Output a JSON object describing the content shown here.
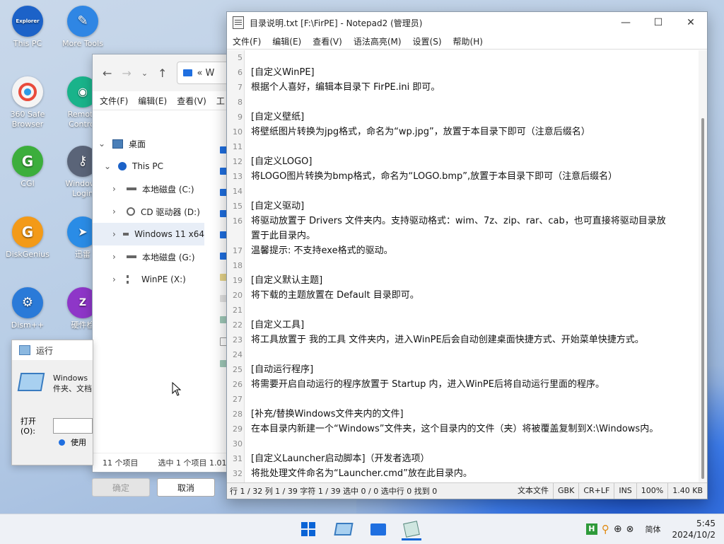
{
  "desktop_icons": [
    {
      "label": "This PC",
      "badge": "Explorer",
      "color": "#1c62c8"
    },
    {
      "label": "More Tools",
      "color": "#2f86e4"
    },
    {
      "label": "360 Safe Browser",
      "color": "#f4f4f4"
    },
    {
      "label": "Remote Control",
      "color": "#19b38a"
    },
    {
      "label": "CGI",
      "badge": "G",
      "color": "#3cae3c"
    },
    {
      "label": "Windows Login",
      "color": "#5a6478"
    },
    {
      "label": "DiskGenius",
      "badge": "G",
      "color": "#f39a18"
    },
    {
      "label": "迅雷",
      "color": "#2a8ce6"
    },
    {
      "label": "Dism++",
      "color": "#2a7ad8"
    },
    {
      "label": "硬件检",
      "badge": "Z",
      "color": "#8e36c8"
    }
  ],
  "explorer": {
    "address": "« W",
    "menu": [
      "文件(F)",
      "编辑(E)",
      "查看(V)",
      "工"
    ],
    "tree": [
      {
        "label": "桌面",
        "indent": 0,
        "expander": "⌄"
      },
      {
        "label": "This PC",
        "indent": 1,
        "expander": "⌄"
      },
      {
        "label": "本地磁盘 (C:)",
        "indent": 2,
        "expander": "›"
      },
      {
        "label": "CD 驱动器 (D:)",
        "indent": 2,
        "expander": "›"
      },
      {
        "label": "Windows 11 x64",
        "indent": 2,
        "expander": "›",
        "selected": true
      },
      {
        "label": "本地磁盘 (G:)",
        "indent": 2,
        "expander": "›"
      },
      {
        "label": "WinPE (X:)",
        "indent": 2,
        "expander": "›"
      }
    ],
    "status_count": "11 个项目",
    "status_selected": "选中 1 个项目 1.01"
  },
  "run_dialog": {
    "title": "运行",
    "desc_line1": "Windows",
    "desc_line2": "件夹、文档",
    "open_label": "打开(O):",
    "admin_label": "使用",
    "ok_label": "确定",
    "cancel_label": "取消"
  },
  "notepad": {
    "title": "目录说明.txt [F:\\FirPE] - Notepad2 (管理员)",
    "menu": [
      "文件(F)",
      "编辑(E)",
      "查看(V)",
      "语法高亮(M)",
      "设置(S)",
      "帮助(H)"
    ],
    "lines": [
      {
        "n": "5",
        "t": ""
      },
      {
        "n": "6",
        "t": "[自定义WinPE]"
      },
      {
        "n": "7",
        "t": "根据个人喜好，编辑本目录下 FirPE.ini 即可。"
      },
      {
        "n": "8",
        "t": ""
      },
      {
        "n": "9",
        "t": "[自定义壁纸]"
      },
      {
        "n": "10",
        "t": "将壁纸图片转换为jpg格式，命名为“wp.jpg”，放置于本目录下即可（注意后缀名）"
      },
      {
        "n": "11",
        "t": ""
      },
      {
        "n": "12",
        "t": "[自定义LOGO]"
      },
      {
        "n": "13",
        "t": "将LOGO图片转换为bmp格式，命名为“LOGO.bmp”,放置于本目录下即可（注意后缀名）"
      },
      {
        "n": "14",
        "t": ""
      },
      {
        "n": "15",
        "t": "[自定义驱动]"
      },
      {
        "n": "16",
        "t": "将驱动放置于 Drivers 文件夹内。支持驱动格式：wim、7z、zip、rar、cab，也可直接将驱动目录放"
      },
      {
        "n": "",
        "t": "置于此目录内。"
      },
      {
        "n": "17",
        "t": "温馨提示: 不支持exe格式的驱动。"
      },
      {
        "n": "18",
        "t": ""
      },
      {
        "n": "19",
        "t": "[自定义默认主题]"
      },
      {
        "n": "20",
        "t": "将下载的主题放置在 Default 目录即可。"
      },
      {
        "n": "21",
        "t": ""
      },
      {
        "n": "22",
        "t": "[自定义工具]"
      },
      {
        "n": "23",
        "t": "将工具放置于 我的工具 文件夹内，进入WinPE后会自动创建桌面快捷方式、开始菜单快捷方式。"
      },
      {
        "n": "24",
        "t": ""
      },
      {
        "n": "25",
        "t": "[自动运行程序]"
      },
      {
        "n": "26",
        "t": "将需要开启自动运行的程序放置于 Startup 内，进入WinPE后将自动运行里面的程序。"
      },
      {
        "n": "27",
        "t": ""
      },
      {
        "n": "28",
        "t": "[补充/替换Windows文件夹内的文件]"
      },
      {
        "n": "29",
        "t": "在本目录内新建一个“Windows”文件夹，这个目录内的文件（夹）将被覆盖复制到X:\\Windows内。"
      },
      {
        "n": "30",
        "t": ""
      },
      {
        "n": "31",
        "t": "[自定义Launcher启动脚本]（开发者选项）"
      },
      {
        "n": "32",
        "t": "将批处理文件命名为“Launcher.cmd”放在此目录内。"
      }
    ],
    "status": {
      "position": "行 1 / 32  列 1 / 39  字符 1 / 39  选中 0 / 0  选中行 0  找到 0",
      "scheme": "文本文件",
      "encoding": "GBK",
      "eol": "CR+LF",
      "ins": "INS",
      "zoom": "100%",
      "size": "1.40 KB"
    }
  },
  "taskbar": {
    "ime": "简体",
    "time": "5:45",
    "date": "2024/10/2"
  },
  "colors": {
    "accent": "#1f6fe0",
    "windows_blue": "#0a64d6"
  }
}
